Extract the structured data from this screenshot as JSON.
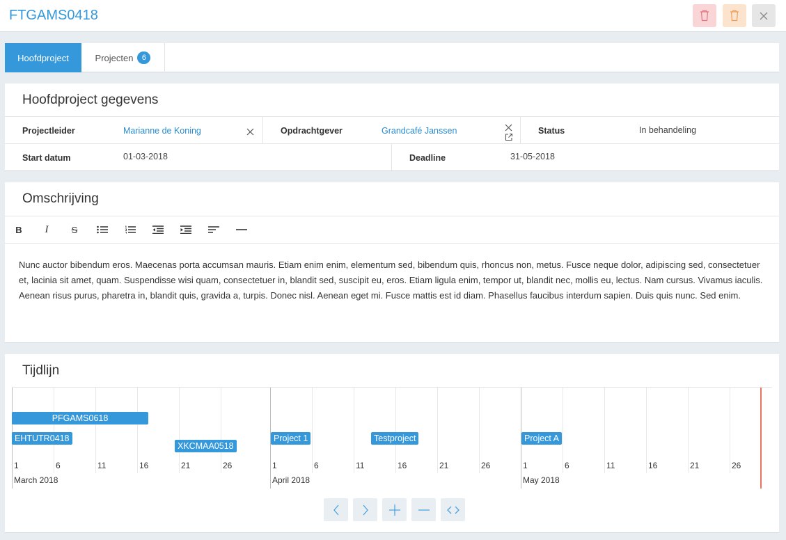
{
  "header": {
    "title": "FTGAMS0418"
  },
  "tabs": [
    {
      "label": "Hoofdproject"
    },
    {
      "label": "Projecten",
      "badge": "6"
    }
  ],
  "details": {
    "heading": "Hoofdproject gegevens",
    "projectleider_label": "Projectleider",
    "projectleider_value": "Marianne de Koning",
    "opdrachtgever_label": "Opdrachtgever",
    "opdrachtgever_value": "Grandcafé Janssen",
    "status_label": "Status",
    "status_value": "In behandeling",
    "start_label": "Start datum",
    "start_value": "01-03-2018",
    "deadline_label": "Deadline",
    "deadline_value": "31-05-2018"
  },
  "description": {
    "heading": "Omschrijving",
    "toolbar": [
      "bold-icon",
      "italic-icon",
      "strikethrough-icon",
      "bullet-list-icon",
      "numbered-list-icon",
      "outdent-icon",
      "indent-icon",
      "align-left-icon",
      "horizontal-rule-icon"
    ],
    "text": "Nunc auctor bibendum eros. Maecenas porta accumsan mauris. Etiam enim enim, elementum sed, bibendum quis, rhoncus non, metus. Fusce neque dolor, adipiscing sed, consectetuer et, lacinia sit amet, quam. Suspendisse wisi quam, consectetuer in, blandit sed, suscipit eu, eros. Etiam ligula enim, tempor ut, blandit nec, mollis eu, lectus. Nam cursus. Vivamus iaculis. Aenean risus purus, pharetra in, blandit quis, gravida a, turpis. Donec nisl. Aenean eget mi. Fusce mattis est id diam. Phasellus faucibus interdum sapien. Duis quis nunc. Sed enim."
  },
  "timeline": {
    "heading": "Tijdlijn",
    "months": [
      "March 2018",
      "April 2018",
      "May 2018"
    ],
    "ticks": [
      "1",
      "6",
      "11",
      "16",
      "21",
      "26"
    ],
    "items": [
      {
        "label": "PFGAMS0618"
      },
      {
        "label": "EHTUTR0418"
      },
      {
        "label": "XKCMAA0518"
      },
      {
        "label": "Project 1"
      },
      {
        "label": "Testproject"
      },
      {
        "label": "Project A"
      }
    ],
    "nav": [
      "chevron-left-icon",
      "chevron-right-icon",
      "zoom-in-icon",
      "zoom-out-icon",
      "code-icon"
    ]
  },
  "colors": {
    "accent": "#3498db",
    "now_line": "#e8735f"
  }
}
